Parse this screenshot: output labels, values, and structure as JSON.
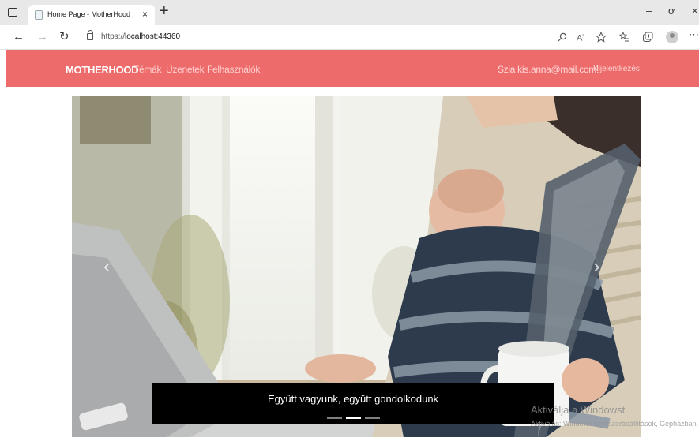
{
  "browser": {
    "tab_title": "Home Page - MotherHood",
    "tab_close": "×",
    "new_tab": "+",
    "url_prefix": "https://",
    "url_host": "localhost:44360",
    "window_controls": [
      "–",
      "ơ",
      "×"
    ],
    "icons": [
      "back-icon",
      "forward-icon",
      "refresh-icon",
      "lock-icon",
      "search-icon",
      "read-aloud-icon",
      "favorite-icon",
      "favorites-list-icon",
      "collections-icon",
      "profile-icon",
      "more-icon"
    ]
  },
  "navbar": {
    "brand": "MOTHERHOOD",
    "links": [
      "Témák",
      "Üzenetek",
      "Felhasználók"
    ],
    "user": "Szia kis.anna@mail.com!",
    "logout": "Kijelentkezés",
    "color": "#ee6b6b"
  },
  "carousel": {
    "caption": "Együtt vagyunk, együtt gondolkodunk",
    "slide_count": 3,
    "active_slide": 2,
    "prev": "‹",
    "next": "›"
  },
  "watermark": {
    "line1": "Aktiválja a Windowst",
    "line2": "Aktiválás: Windows rendszerbeállítások, Gépházban."
  }
}
